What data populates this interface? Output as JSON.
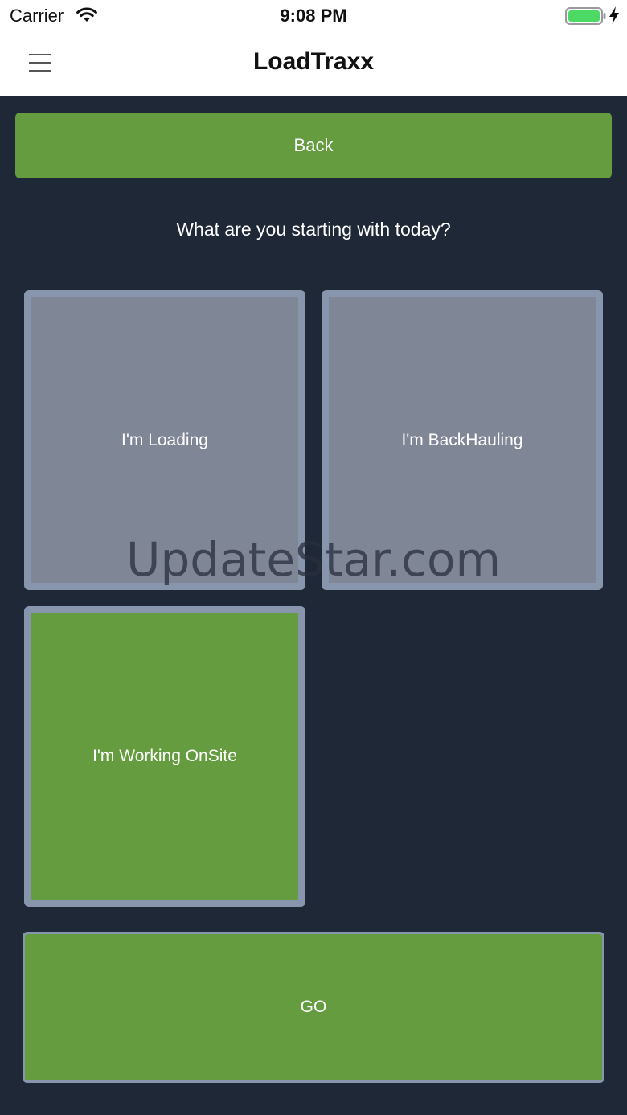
{
  "status_bar": {
    "carrier": "Carrier",
    "time": "9:08 PM",
    "icons": [
      "wifi-icon",
      "battery-icon",
      "charging-bolt-icon"
    ]
  },
  "nav": {
    "title": "LoadTraxx",
    "menu_icon": "hamburger-menu-icon"
  },
  "main": {
    "back_label": "Back",
    "question": "What are you starting with today?",
    "options": [
      {
        "label": "I'm Loading",
        "selected": false
      },
      {
        "label": "I'm BackHauling",
        "selected": false
      },
      {
        "label": "I'm Working OnSite",
        "selected": true
      }
    ],
    "go_label": "GO"
  },
  "watermark": "UpdateStar.com",
  "colors": {
    "background": "#1f2836",
    "accent_green": "#659c40",
    "tile_gray": "#7f8696",
    "tile_border": "#8796ad",
    "battery_green": "#4cd964"
  }
}
